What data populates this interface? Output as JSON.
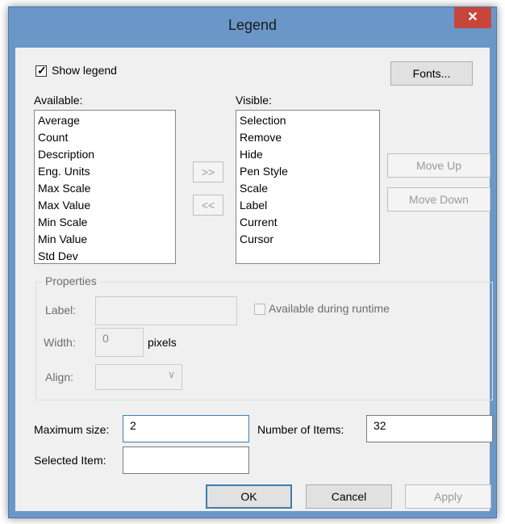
{
  "window": {
    "title": "Legend",
    "close_glyph": "✕"
  },
  "show_legend": {
    "label": "Show legend",
    "checked": true
  },
  "fonts_button": "Fonts...",
  "available": {
    "label": "Available:",
    "items": [
      "Average",
      "Count",
      "Description",
      "Eng. Units",
      "Max Scale",
      "Max Value",
      "Min Scale",
      "Min Value",
      "Std Dev"
    ]
  },
  "visible": {
    "label": "Visible:",
    "items": [
      "Selection",
      "Remove",
      "Hide",
      "Pen Style",
      "Scale",
      "Label",
      "Current",
      "Cursor"
    ]
  },
  "move_buttons": {
    "add": ">>",
    "remove": "<<",
    "up": "Move Up",
    "down": "Move Down"
  },
  "properties": {
    "caption": "Properties",
    "label_caption": "Label:",
    "label_value": "",
    "available_runtime": "Available during runtime",
    "width_caption": "Width:",
    "width_value": "0",
    "width_unit": "pixels",
    "align_caption": "Align:",
    "align_value": ""
  },
  "maximum_size": {
    "label": "Maximum size:",
    "value": "2"
  },
  "number_of_items": {
    "label": "Number of Items:",
    "value": "32"
  },
  "selected_item": {
    "label": "Selected Item:",
    "value": ""
  },
  "footer": {
    "ok": "OK",
    "cancel": "Cancel",
    "apply": "Apply"
  },
  "icons": {
    "close": "close-icon",
    "check": "checkmark-icon",
    "dropdown": "chevron-down-icon"
  },
  "colors": {
    "titlebar": "#6b96c8",
    "close": "#c7463c",
    "dialog_bg": "#f0f0f0",
    "focus_border": "#3c7fb1"
  }
}
